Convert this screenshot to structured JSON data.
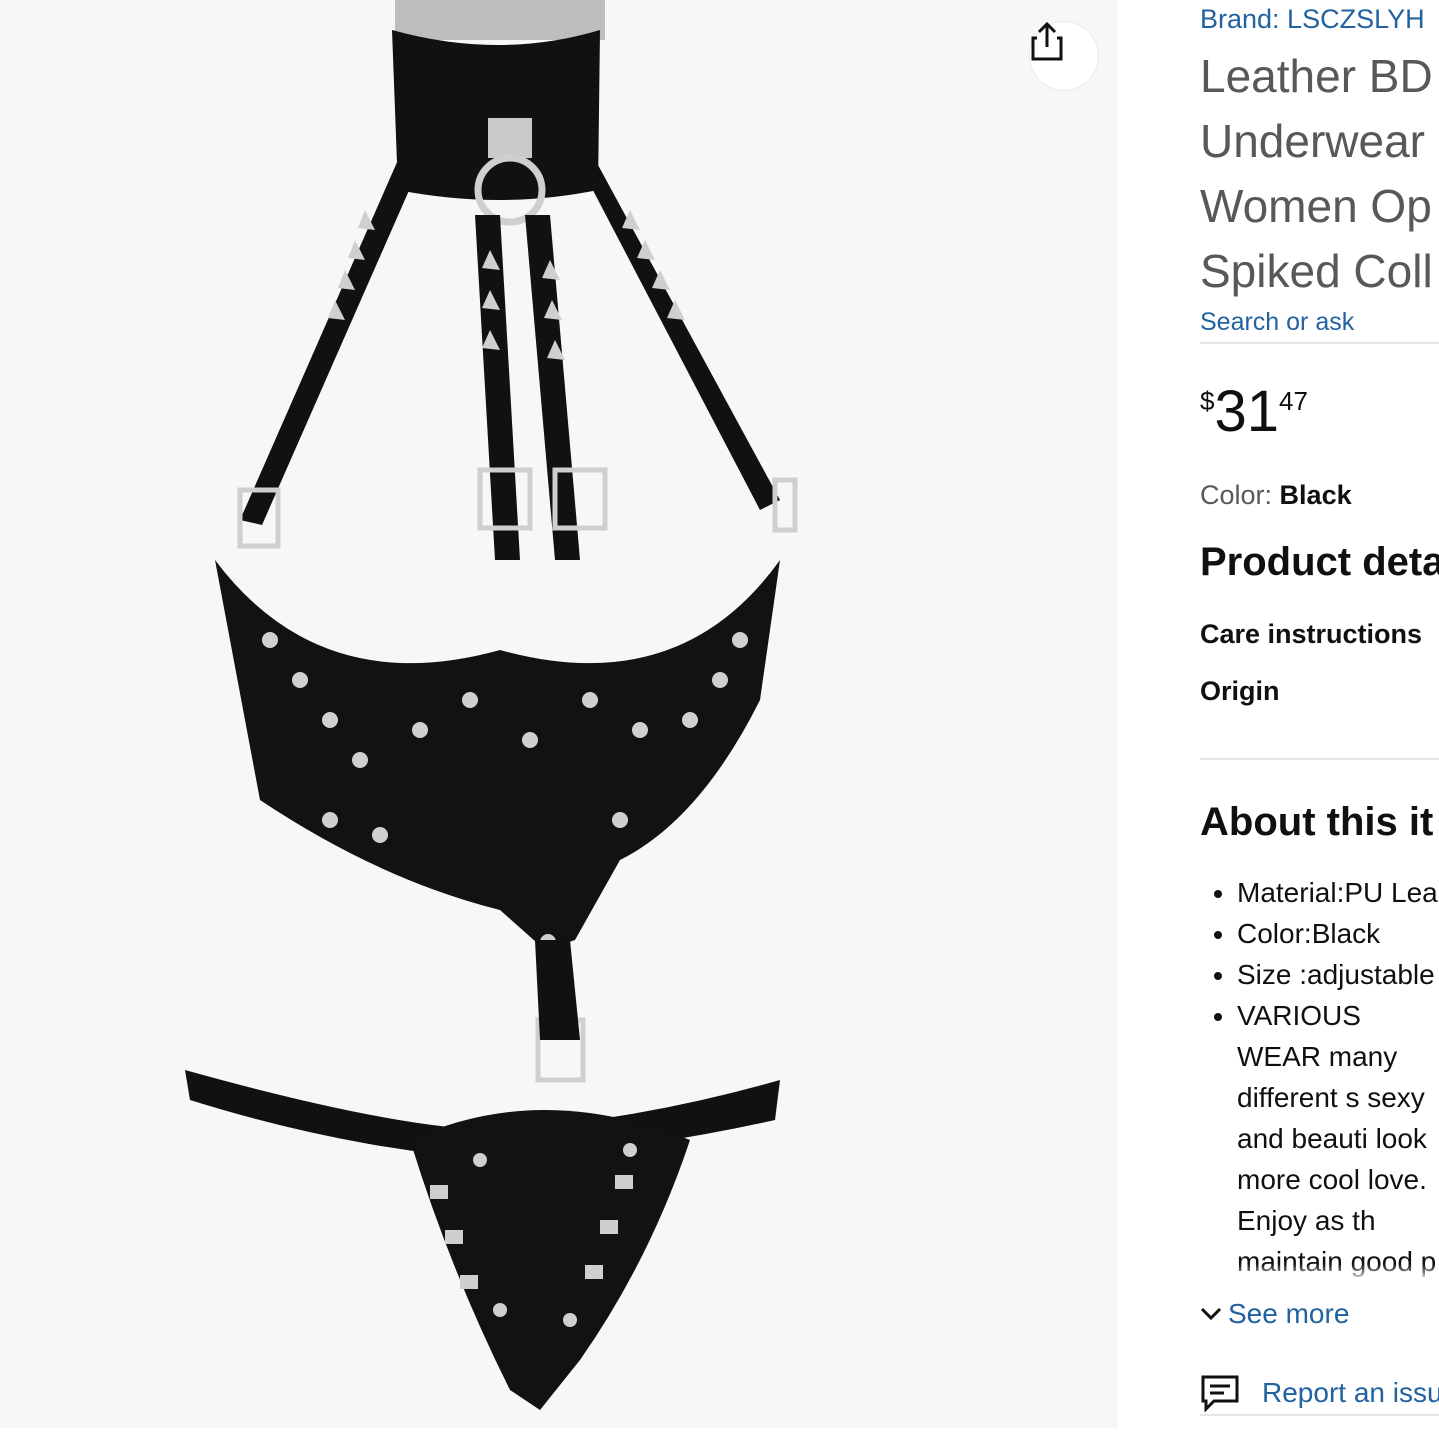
{
  "product": {
    "brand": "Brand: LSCZSLYH",
    "title_lines": [
      "Leather BD",
      "Underwear",
      "Women Op",
      "Spiked Coll"
    ],
    "search_ask": "Search or ask",
    "price": {
      "symbol": "$",
      "whole": "31",
      "fraction": "47"
    },
    "color": {
      "label": "Color:",
      "value": "Black"
    }
  },
  "details": {
    "heading": "Product deta",
    "rows": [
      "Care instructions",
      "Origin"
    ]
  },
  "about": {
    "heading": "About this it",
    "bullets": [
      "Material:PU Lea",
      "Color:Black",
      "Size :adjustable",
      "VARIOUS WEAR many different s sexy and beauti look more cool love. Enjoy as th maintain good p prevents them f"
    ],
    "see_more": "See more"
  },
  "report": {
    "label": "Report an issu"
  },
  "icons": {
    "share": "share-icon",
    "chevron": "chevron-down-icon",
    "report": "report-flag-icon"
  },
  "colors": {
    "link": "#2162a1",
    "muted": "#565959",
    "text": "#0f1111"
  }
}
